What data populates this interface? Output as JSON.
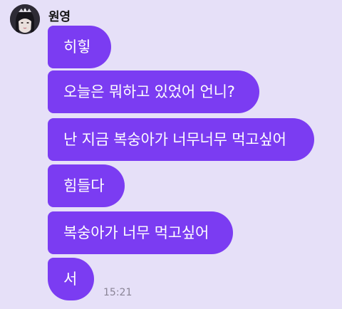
{
  "chat": {
    "sender_name": "원영",
    "messages": [
      {
        "text": "히힣"
      },
      {
        "text": "오늘은 뭐하고 있었어 언니?"
      },
      {
        "text": "난 지금 복숭아가 너무너무 먹고싶어"
      },
      {
        "text": "힘들다"
      },
      {
        "text": "복숭아가 너무 먹고싶어"
      },
      {
        "text": "서"
      }
    ],
    "timestamp": "15:21"
  },
  "colors": {
    "background": "#e6e0f8",
    "bubble": "#7b3cf2",
    "bubble_text": "#ffffff",
    "timestamp_text": "#8a8496"
  },
  "icons": {
    "avatar": "profile-photo"
  }
}
